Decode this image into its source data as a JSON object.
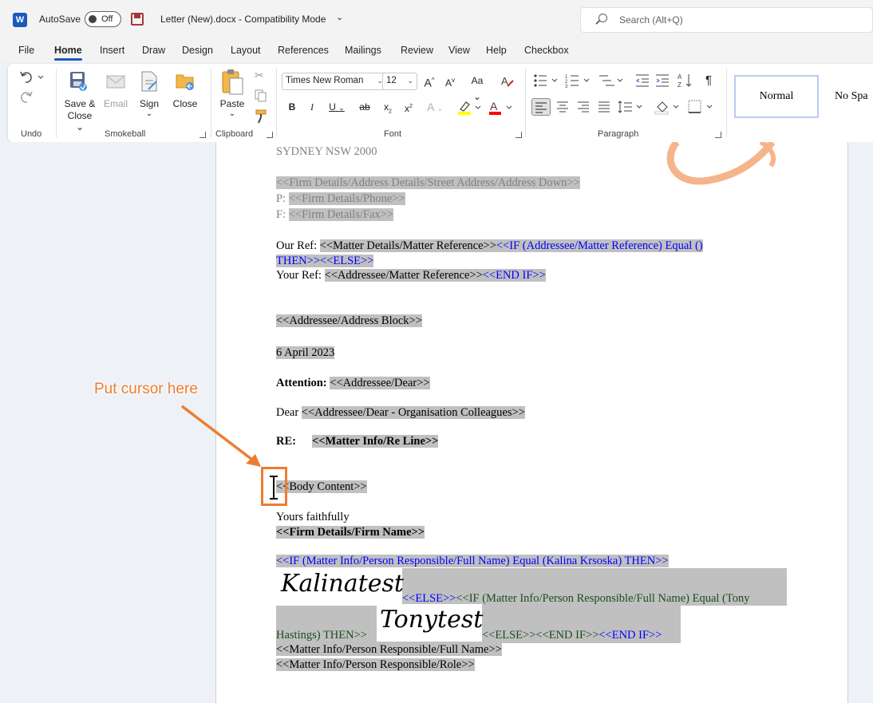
{
  "titlebar": {
    "app_icon": "W",
    "autosave_label": "AutoSave",
    "autosave_state": "Off",
    "doc_title": "Letter (New).docx  -  Compatibility Mode",
    "search_placeholder": "Search (Alt+Q)"
  },
  "tabs": [
    "File",
    "Home",
    "Insert",
    "Draw",
    "Design",
    "Layout",
    "References",
    "Mailings",
    "Review",
    "View",
    "Help",
    "Checkbox"
  ],
  "active_tab": "Home",
  "ribbon": {
    "groups": {
      "undo": "Undo",
      "smokeball": "Smokeball",
      "clipboard": "Clipboard",
      "font": "Font",
      "paragraph": "Paragraph"
    },
    "smokeball_buttons": {
      "save_close": "Save &",
      "save_close_2": "Close",
      "email": "Email",
      "sign": "Sign",
      "close": "Close"
    },
    "paste": "Paste",
    "font_name": "Times New Roman",
    "font_size": "12",
    "format_buttons": {
      "bold": "B",
      "italic": "I",
      "underline": "U",
      "strike": "ab",
      "subscript": "x",
      "superscript": "x",
      "grow": "A",
      "shrink": "A",
      "case": "Aa",
      "text_effects": "A",
      "font_color": "A"
    },
    "paragraph_mark": "¶",
    "styles": {
      "normal": "Normal",
      "no_spacing": "No Spa"
    }
  },
  "document": {
    "city": "SYDNEY NSW 2000",
    "firm_address": "<<Firm Details/Address Details/Street Address/Address Down>>",
    "phone_label": "P: ",
    "phone": "<<Firm Details/Phone>>",
    "fax_label": "F: ",
    "fax": "<<Firm Details/Fax>>",
    "our_ref_label": "Our Ref: ",
    "our_ref": "<<Matter Details/Matter Reference>>",
    "our_ref_if": "<<IF (Addressee/Matter Reference) Equal ()",
    "our_ref_then": "THEN>><<ELSE>>",
    "your_ref_label": "Your Ref: ",
    "your_ref": "<<Addressee/Matter Reference>>",
    "your_ref_endif": "<<END IF>>",
    "address_block": "<<Addressee/Address Block>>",
    "date": "6 April 2023",
    "attention_label": "Attention: ",
    "attention": "<<Addressee/Dear>>",
    "dear_label": "Dear ",
    "dear": "<<Addressee/Dear - Organisation Colleagues>>",
    "re_label": "RE:",
    "re_line": "<<Matter Info/Re Line>>",
    "body": "<<Body Content>>",
    "closing": "Yours faithfully",
    "firm_name": "<<Firm Details/Firm Name>>",
    "if_kalina": "<<IF (Matter Info/Person Responsible/Full Name) Equal (Kalina Krsoska) THEN>>",
    "sig1": "Kalinatest",
    "else1": "<<ELSE>>",
    "if_tony": "<<IF (Matter Info/Person Responsible/Full Name) Equal (Tony",
    "hastings": "Hastings) THEN>>",
    "sig2": "Tonytest",
    "else_endif": "<<ELSE>><<END IF>>",
    "endif_blue": "<<END IF>>",
    "person_full_name": "<<Matter Info/Person Responsible/Full Name>>",
    "person_role": "<<Matter Info/Person Responsible/Role>>"
  },
  "annotation": {
    "text": "Put cursor here",
    "color": "#ed7d31"
  },
  "colors": {
    "accent": "#185abd",
    "field_highlight": "#c0c0c0",
    "field_blue": "#0000ff"
  }
}
